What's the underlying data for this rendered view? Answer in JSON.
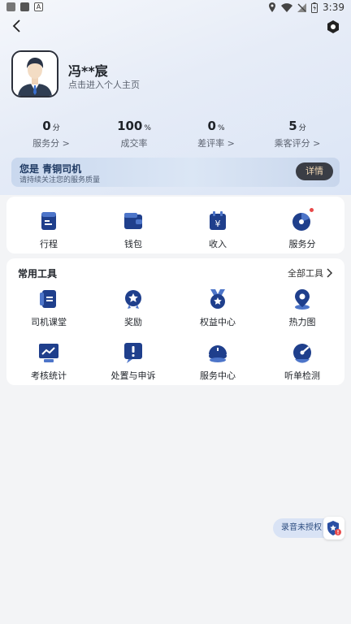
{
  "status_bar": {
    "time": "3:39"
  },
  "profile": {
    "name": "冯**宸",
    "subtitle": "点击进入个人主页"
  },
  "stats": [
    {
      "value": "0",
      "unit": "分",
      "label": "服务分 >"
    },
    {
      "value": "100",
      "unit": "%",
      "label": "成交率"
    },
    {
      "value": "0",
      "unit": "%",
      "label": "差评率 >"
    },
    {
      "value": "5",
      "unit": "分",
      "label": "乘客评分 >"
    }
  ],
  "banner": {
    "title": "您是 青铜司机",
    "subtitle": "请持续关注您的服务质量",
    "button": "详情"
  },
  "quick_actions": [
    {
      "label": "行程",
      "icon": "itinerary-icon"
    },
    {
      "label": "钱包",
      "icon": "wallet-icon"
    },
    {
      "label": "收入",
      "icon": "income-icon"
    },
    {
      "label": "服务分",
      "icon": "service-score-icon",
      "badge": true
    }
  ],
  "tools": {
    "title": "常用工具",
    "more": "全部工具",
    "items": [
      {
        "label": "司机课堂",
        "icon": "driver-class-icon"
      },
      {
        "label": "奖励",
        "icon": "reward-icon"
      },
      {
        "label": "权益中心",
        "icon": "benefits-icon"
      },
      {
        "label": "热力图",
        "icon": "heatmap-icon"
      },
      {
        "label": "考核统计",
        "icon": "assessment-icon"
      },
      {
        "label": "处置与申诉",
        "icon": "appeal-icon"
      },
      {
        "label": "服务中心",
        "icon": "service-center-icon"
      },
      {
        "label": "听单检测",
        "icon": "order-detect-icon"
      }
    ]
  },
  "record": {
    "label": "录音未授权"
  },
  "colors": {
    "accent": "#2a4fa3",
    "icon_dark": "#1f3f8c",
    "badge": "#e84a4a"
  }
}
